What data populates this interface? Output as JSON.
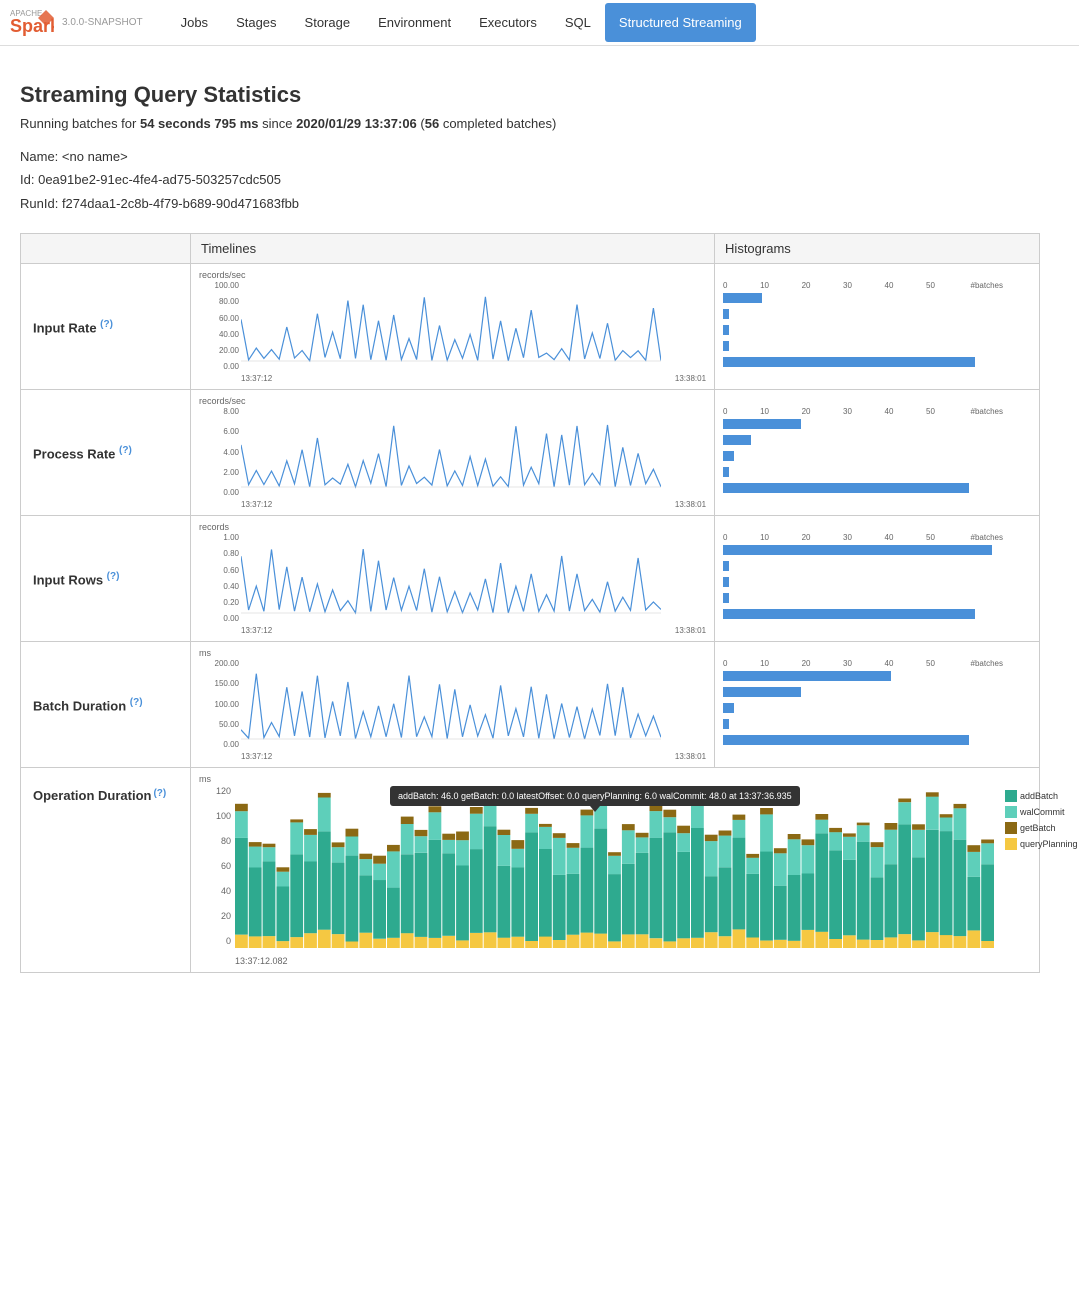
{
  "nav": {
    "logo": "Spark",
    "apache": "APACHE",
    "version": "3.0.0-SNAPSHOT",
    "links": [
      "Jobs",
      "Stages",
      "Storage",
      "Environment",
      "Executors",
      "SQL",
      "Structured Streaming"
    ],
    "active": "Structured Streaming"
  },
  "page": {
    "title": "Streaming Query Statistics",
    "subtitle_pre": "Running batches for ",
    "subtitle_duration": "54 seconds 795 ms",
    "subtitle_mid": " since ",
    "subtitle_since": "2020/01/29 13:37:06",
    "subtitle_post_pre": " (",
    "subtitle_batches": "56",
    "subtitle_post": " completed batches)",
    "name_label": "Name:",
    "name_value": "<no name>",
    "id_label": "Id:",
    "id_value": "0ea91be2-91ec-4fe4-ad75-503257cdc505",
    "runid_label": "RunId:",
    "runid_value": "f274daa1-2c8b-4f79-b689-90d471683fbb"
  },
  "table": {
    "col_timelines": "Timelines",
    "col_histograms": "Histograms"
  },
  "rows": [
    {
      "id": "input-rate",
      "label": "Input Rate",
      "unit_timeline": "records/sec",
      "yaxis": [
        "100.00",
        "80.00",
        "60.00",
        "40.00",
        "20.00",
        "0.00"
      ],
      "x_start": "13:37:12",
      "x_end": "13:38:01",
      "unit_histogram": "#batches",
      "hist_ticks": [
        "0",
        "10",
        "20",
        "30",
        "40",
        "50"
      ],
      "hist_bars": [
        {
          "y": 8,
          "width_pct": 14
        },
        {
          "y": 22,
          "width_pct": 2
        },
        {
          "y": 36,
          "width_pct": 2
        },
        {
          "y": 50,
          "width_pct": 2
        },
        {
          "y": 64,
          "width_pct": 90
        }
      ]
    },
    {
      "id": "process-rate",
      "label": "Process Rate",
      "unit_timeline": "records/sec",
      "yaxis": [
        "8.00",
        "6.00",
        "4.00",
        "2.00",
        "0.00"
      ],
      "x_start": "13:37:12",
      "x_end": "13:38:01",
      "unit_histogram": "#batches",
      "hist_ticks": [
        "0",
        "10",
        "20",
        "30",
        "40",
        "50"
      ],
      "hist_bars": [
        {
          "y": 8,
          "width_pct": 28
        },
        {
          "y": 22,
          "width_pct": 10
        },
        {
          "y": 36,
          "width_pct": 4
        },
        {
          "y": 50,
          "width_pct": 2
        },
        {
          "y": 64,
          "width_pct": 88
        }
      ]
    },
    {
      "id": "input-rows",
      "label": "Input Rows",
      "unit_timeline": "records",
      "yaxis": [
        "1.00",
        "0.80",
        "0.60",
        "0.40",
        "0.20",
        "0.00"
      ],
      "x_start": "13:37:12",
      "x_end": "13:38:01",
      "unit_histogram": "#batches",
      "hist_ticks": [
        "0",
        "10",
        "20",
        "30",
        "40",
        "50"
      ],
      "hist_bars": [
        {
          "y": 8,
          "width_pct": 96
        },
        {
          "y": 22,
          "width_pct": 2
        },
        {
          "y": 36,
          "width_pct": 2
        },
        {
          "y": 50,
          "width_pct": 2
        },
        {
          "y": 64,
          "width_pct": 90
        }
      ]
    },
    {
      "id": "batch-duration",
      "label": "Batch Duration",
      "unit_timeline": "ms",
      "yaxis": [
        "200.00",
        "150.00",
        "100.00",
        "50.00",
        "0.00"
      ],
      "x_start": "13:37:12",
      "x_end": "13:38:01",
      "unit_histogram": "#batches",
      "hist_ticks": [
        "0",
        "10",
        "20",
        "30",
        "40",
        "50"
      ],
      "hist_bars": [
        {
          "y": 8,
          "width_pct": 60
        },
        {
          "y": 22,
          "width_pct": 28
        },
        {
          "y": 36,
          "width_pct": 4
        },
        {
          "y": 50,
          "width_pct": 2
        },
        {
          "y": 64,
          "width_pct": 88
        }
      ]
    }
  ],
  "operation_duration": {
    "label": "Operation Duration",
    "unit": "ms",
    "x_start": "13:37:12.082",
    "tooltip": "addBatch: 46.0 getBatch: 0.0 latestOffset: 0.0 queryPlanning: 6.0 walCommit: 48.0 at 13:37:36.935",
    "legend": [
      {
        "color": "#2eaa8f",
        "label": "addBatch"
      },
      {
        "color": "#5ecfba",
        "label": "walCommit"
      },
      {
        "color": "#8b6914",
        "label": "getBatch"
      },
      {
        "color": "#f5c842",
        "label": "queryPlanning"
      }
    ],
    "yaxis": [
      "120",
      "100",
      "80",
      "60",
      "40",
      "20",
      "0"
    ]
  },
  "colors": {
    "accent": "#4a90d9",
    "spark_red": "#e25d33",
    "chart_blue": "#4a90d9",
    "bar_blue": "#4a90d9"
  }
}
